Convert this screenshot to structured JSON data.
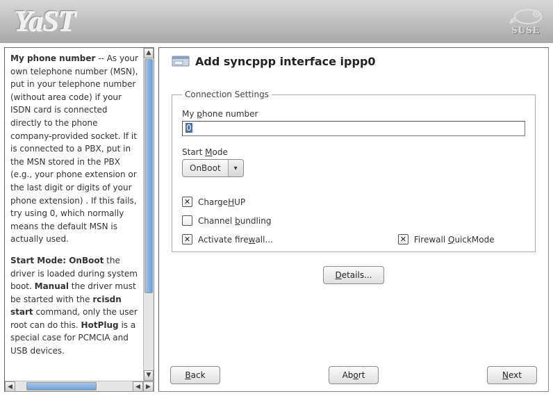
{
  "app": {
    "name": "YaST",
    "brand": "SUSE"
  },
  "help": {
    "p1_lead": "My phone number",
    "p1_rest": " -- As your own telephone number (MSN), put in your telephone number (without area code) if your ISDN card is connected directly to the phone company-provided socket. If it is connected to a PBX, put in the MSN stored in the PBX (e.g., your phone extension or the last digit or digits of your phone extension) . If this fails, try using 0, which normally means the default MSN is actually used.",
    "p2_lead": "Start Mode: OnBoot",
    "p2_mid1": " the driver is loaded during system boot. ",
    "p2_manual": "Manual",
    "p2_mid2": " the driver must be started with the ",
    "p2_cmd": "rcisdn start",
    "p2_mid3": " command, only the user root can do this. ",
    "p2_hotplug": "HotPlug",
    "p2_tail": " is a special case for PCMCIA and USB devices."
  },
  "main": {
    "title": "Add syncppp interface ippp0",
    "fieldset_legend": "Connection Settings",
    "phone_label_pre": "My ",
    "phone_label_u": "p",
    "phone_label_post": "hone number",
    "phone_value": "0",
    "startmode_label_pre": "Start ",
    "startmode_label_u": "M",
    "startmode_label_post": "ode",
    "startmode_value": "OnBoot",
    "cb": {
      "chargehup": {
        "checked": true,
        "label_pre": "Charge",
        "label_u": "H",
        "label_post": "UP"
      },
      "bundling": {
        "checked": false,
        "label_pre": "Channel ",
        "label_u": "b",
        "label_post": "undling"
      },
      "firewall": {
        "checked": true,
        "label_pre": "Activate fire",
        "label_u": "w",
        "label_post": "all..."
      },
      "quick": {
        "checked": true,
        "label_pre": "Firewall ",
        "label_u": "Q",
        "label_post": "uickMode"
      }
    },
    "details_pre": "",
    "details_u": "D",
    "details_post": "etails...",
    "back_pre": "",
    "back_u": "B",
    "back_post": "ack",
    "abort_pre": "Ab",
    "abort_u": "o",
    "abort_post": "rt",
    "next_pre": "",
    "next_u": "N",
    "next_post": "ext"
  }
}
